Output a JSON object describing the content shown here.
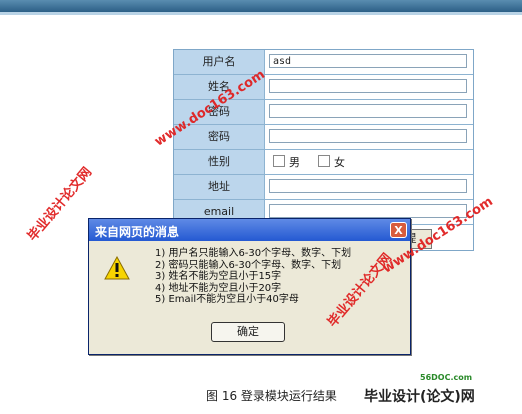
{
  "form": {
    "username_label": "用户名",
    "username_value": "asd",
    "name_label": "姓名",
    "password_label": "密码",
    "confirm_label": "密码",
    "gender_label": "性别",
    "gender_male": "男",
    "gender_female": "女",
    "address_label": "地址",
    "email_label": "email",
    "submit_label": "提"
  },
  "dialog": {
    "title": "来自网页的消息",
    "close": "X",
    "messages": [
      "1) 用户名只能输入6-30个字母、数字、下划",
      "2) 密码只能输入6-30个字母、数字、下划",
      "3) 姓名不能为空且小于15字",
      "4) 地址不能为空且小于20字",
      "5) Email不能为空且小于40字母"
    ],
    "ok_label": "确定"
  },
  "caption": "图 16   登录模块运行结果",
  "watermarks": {
    "cn": "毕业设计论文网",
    "url": "www.doc163.com"
  },
  "logo": {
    "main": "毕业设计(论文)网",
    "sub": "56DOC.com"
  },
  "colors": {
    "label_bg": "#bcd6ec",
    "dialog_title": "#2459d2",
    "watermark": "#e02020"
  }
}
